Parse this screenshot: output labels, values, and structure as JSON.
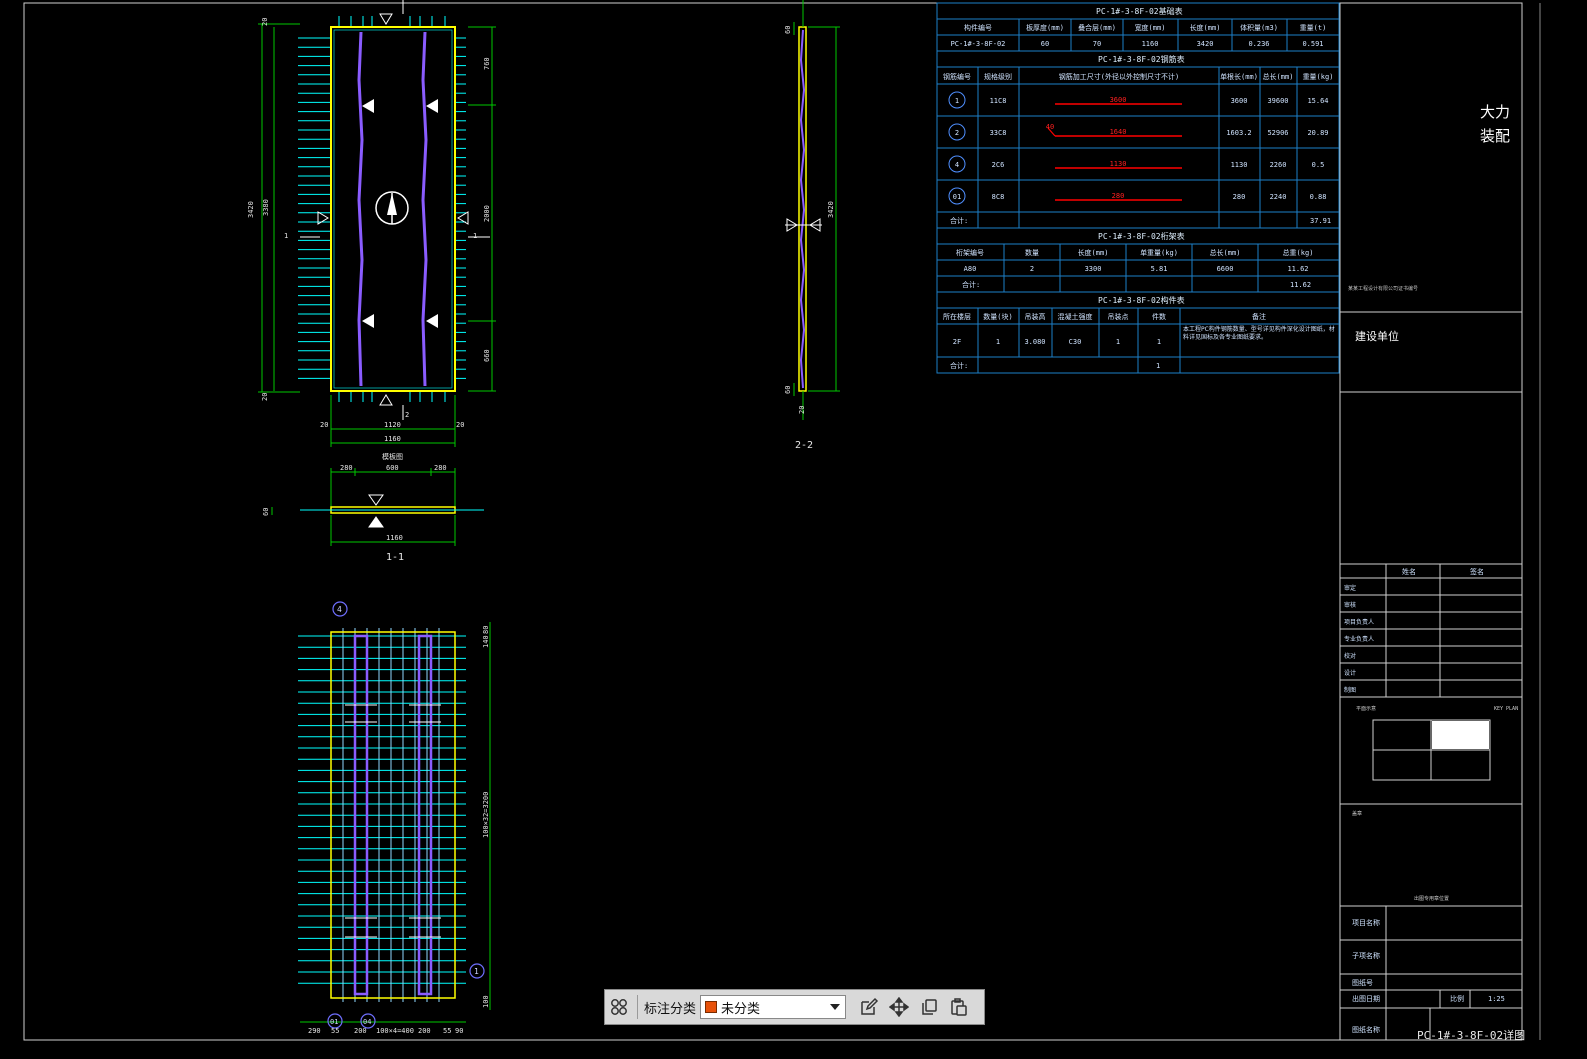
{
  "drawing": {
    "plan_dims": {
      "top_1": "760",
      "mid": "2000",
      "bottom_1": "660",
      "left_total": "3420",
      "left_inner": "3380",
      "left_edge": "20",
      "bottom_w1": "1120",
      "bottom_w2": "1160",
      "side_20": "20",
      "section_mark": "1",
      "section_mark2": "2"
    },
    "plan_title": "模板图",
    "section11": {
      "d1": "280",
      "d2": "600",
      "d3": "280",
      "w": "1160",
      "thick": "60",
      "label": "1-1"
    },
    "section22": {
      "h": "3420",
      "top": "60",
      "bottom": "60",
      "label": "2-2",
      "side": "20"
    },
    "rebar_plan": {
      "right_dim": "100×32=3200",
      "right_top": "140",
      "right_top2": "80",
      "right_bottom": "100",
      "bottom_dims": [
        "290",
        "55",
        "200",
        "100×4=400",
        "200",
        "55",
        "90"
      ],
      "markers": [
        "4",
        "1",
        "01",
        "04"
      ]
    }
  },
  "tables": {
    "info": {
      "title": "PC-1#-3-8F-02基础表",
      "headers": [
        "构件编号",
        "板厚度(mm)",
        "叠合层(mm)",
        "宽度(mm)",
        "长度(mm)",
        "体积量(m3)",
        "重量(t)"
      ],
      "row": [
        "PC-1#-3-8F-02",
        "60",
        "70",
        "1160",
        "3420",
        "0.236",
        "0.591"
      ]
    },
    "rebar": {
      "title": "PC-1#-3-8F-02钢筋表",
      "headers": [
        "钢筋编号",
        "规格级别",
        "钢筋加工尺寸(外径以外控制尺寸不计)",
        "单根长(mm)",
        "总长(mm)",
        "重量(kg)"
      ],
      "rows": [
        {
          "no": "1",
          "spec": "11C8",
          "shape": "3600",
          "len": "3600",
          "total": "39600",
          "wt": "15.64"
        },
        {
          "no": "2",
          "spec": "33C8",
          "shape": "1640",
          "hook": "40",
          "len": "1603.2",
          "total": "52906",
          "wt": "20.89"
        },
        {
          "no": "4",
          "spec": "2C6",
          "shape": "1130",
          "len": "1130",
          "total": "2260",
          "wt": "0.5"
        },
        {
          "no": "01",
          "spec": "8C8",
          "shape": "280",
          "len": "280",
          "total": "2240",
          "wt": "0.88"
        }
      ],
      "sum_label": "合计:",
      "sum": "37.91"
    },
    "truss": {
      "title": "PC-1#-3-8F-02桁架表",
      "headers": [
        "桁架编号",
        "数量",
        "长度(mm)",
        "单重量(kg)",
        "总长(mm)",
        "总重(kg)"
      ],
      "row": [
        "A80",
        "2",
        "3300",
        "5.81",
        "6600",
        "11.62"
      ],
      "sum_label": "合计:",
      "sum": "11.62"
    },
    "piece": {
      "title": "PC-1#-3-8F-02构件表",
      "headers": [
        "所在楼层",
        "数量(块)",
        "吊装高",
        "混凝土强度",
        "吊装点",
        "件数",
        "备注"
      ],
      "row": [
        "2F",
        "1",
        "3.080",
        "C30",
        "1",
        "1"
      ],
      "note": "本工程PC构件钢筋数量、型号详见构件深化设计图纸，材料详见国标及各专业图纸要求。",
      "sum_label": "合计:",
      "sum": "1"
    }
  },
  "titleblock": {
    "company": "大力装配",
    "company_note": "某某工程设计有限公司证书编号",
    "client": "建设单位",
    "sig_headers": [
      "姓名",
      "签名"
    ],
    "roles": [
      "审定",
      "审核",
      "项目负责人",
      "专业负责人",
      "校对",
      "设计",
      "制图"
    ],
    "keyplan_left": "平面示意",
    "keyplan_right": "KEY PLAN",
    "stamp": "盖章",
    "stamp_note": "出图专用章位置",
    "project_name": "项目名称",
    "subproject": "子项名称",
    "drawing_no": "图纸号",
    "drawing_date": "出图日期",
    "scale_label": "比例",
    "scale": "1:25",
    "drawing_name_label": "图纸名称",
    "drawing_name": "PC-1#-3-8F-02详图"
  },
  "toolbar": {
    "label": "标注分类",
    "category": "未分类",
    "category_color": "#e8520a"
  },
  "colors": {
    "frame": "#ffffff",
    "table": "#1d7fc8",
    "dim": "#00c800",
    "slab": "#ffff00",
    "rebar": "#00ffff",
    "truss": "#8a5cff",
    "shape": "#ff0000"
  }
}
